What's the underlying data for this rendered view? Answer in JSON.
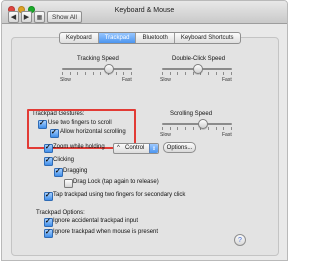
{
  "window": {
    "title": "Keyboard & Mouse",
    "show_all": "Show All"
  },
  "tabs": [
    "Keyboard",
    "Trackpad",
    "Bluetooth",
    "Keyboard Shortcuts"
  ],
  "active_tab": "Trackpad",
  "tracking_speed": {
    "label": "Tracking Speed",
    "min_label": "Slow",
    "max_label": "Fast",
    "value_fraction": 0.62
  },
  "double_click_speed": {
    "label": "Double-Click Speed",
    "min_label": "Slow",
    "max_label": "Fast",
    "value_fraction": 0.48
  },
  "gestures": {
    "title": "Trackpad Gestures:",
    "two_fingers_scroll": {
      "label": "Use two fingers to scroll",
      "checked": true
    },
    "allow_horizontal": {
      "label": "Allow horizontal scrolling",
      "checked": true
    }
  },
  "scrolling_speed": {
    "label": "Scrolling Speed",
    "min_label": "Slow",
    "max_label": "Fast",
    "value_fraction": 0.55
  },
  "zoom": {
    "label": "Zoom while holding",
    "checked": true,
    "select_symbol": "^",
    "select_value": "Control",
    "options_label": "Options..."
  },
  "clicking": {
    "label": "Clicking",
    "checked": true
  },
  "dragging": {
    "label": "Dragging",
    "checked": true
  },
  "drag_lock": {
    "label": "Drag Lock (tap again to release)",
    "checked": false
  },
  "tap_secondary": {
    "label": "Tap trackpad using two fingers for secondary click",
    "checked": true
  },
  "trackpad_options": {
    "title": "Trackpad Options:",
    "ignore_accidental": {
      "label": "Ignore accidental trackpad input",
      "checked": true
    },
    "ignore_when_mouse": {
      "label": "Ignore trackpad when mouse is present",
      "checked": true
    }
  },
  "help": "?",
  "colors": {
    "accent": "#4b95ef",
    "highlight_red": "#e23b35"
  }
}
